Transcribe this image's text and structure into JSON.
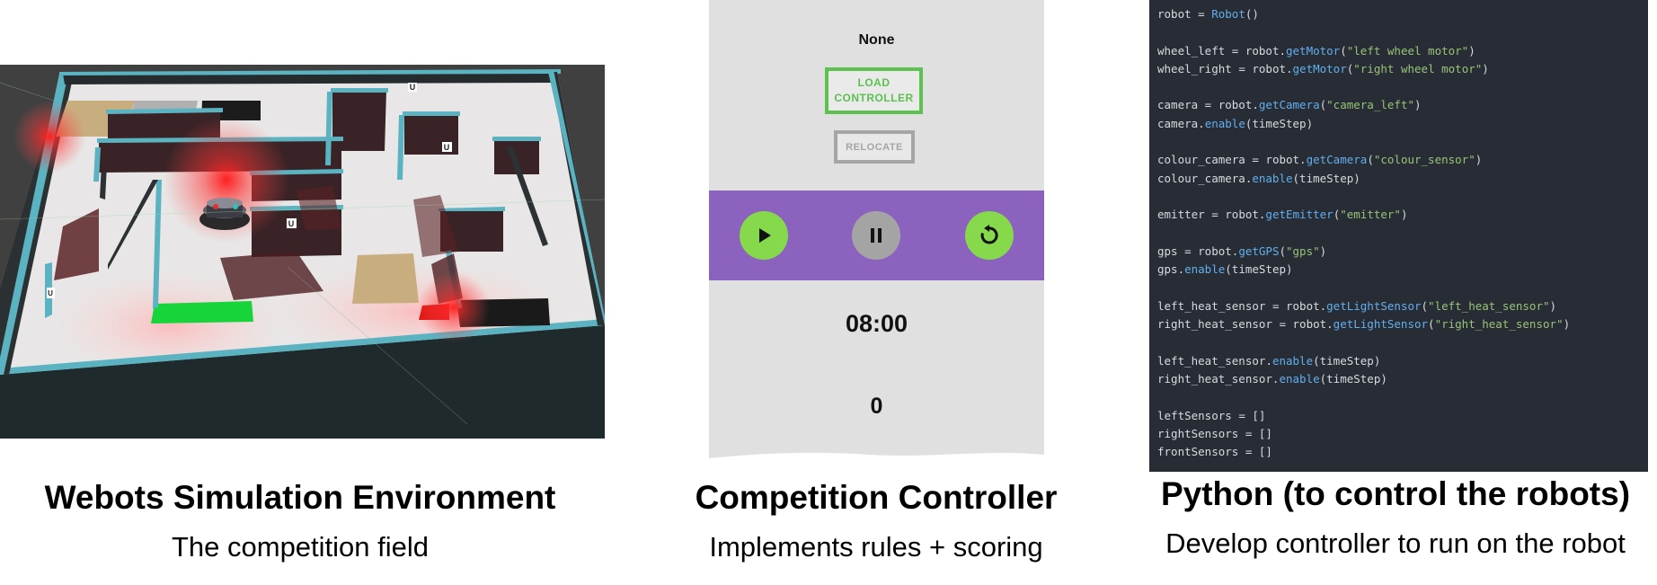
{
  "simulation": {
    "marker_labels": [
      "U",
      "U",
      "U",
      "U"
    ],
    "caption_title": "Webots Simulation Environment",
    "caption_subtitle": "The competition field"
  },
  "controller": {
    "status_label": "None",
    "load_button_label": "LOAD\nCONTROLLER",
    "relocate_button_label": "RELOCATE",
    "timer": "08:00",
    "score": "0",
    "colors": {
      "control_bar": "#8b63bf",
      "active_button": "#86d94a",
      "inactive_button": "#a4a4a4",
      "load_border": "#5cc14e"
    },
    "icons": [
      "play-icon",
      "pause-icon",
      "reset-icon"
    ],
    "caption_title": "Competition Controller",
    "caption_subtitle": "Implements rules + scoring"
  },
  "code": {
    "lines": [
      [
        [
          "var",
          "robot"
        ],
        [
          "op",
          " = "
        ],
        [
          "call",
          "Robot"
        ],
        [
          "punc",
          "()"
        ]
      ],
      [],
      [
        [
          "var",
          "wheel_left"
        ],
        [
          "op",
          " = "
        ],
        [
          "var",
          "robot."
        ],
        [
          "call",
          "getMotor"
        ],
        [
          "punc",
          "("
        ],
        [
          "str",
          "\"left wheel motor\""
        ],
        [
          "punc",
          ")"
        ]
      ],
      [
        [
          "var",
          "wheel_right"
        ],
        [
          "op",
          " = "
        ],
        [
          "var",
          "robot."
        ],
        [
          "call",
          "getMotor"
        ],
        [
          "punc",
          "("
        ],
        [
          "str",
          "\"right wheel motor\""
        ],
        [
          "punc",
          ")"
        ]
      ],
      [],
      [
        [
          "var",
          "camera"
        ],
        [
          "op",
          " = "
        ],
        [
          "var",
          "robot."
        ],
        [
          "call",
          "getCamera"
        ],
        [
          "punc",
          "("
        ],
        [
          "str",
          "\"camera_left\""
        ],
        [
          "punc",
          ")"
        ]
      ],
      [
        [
          "var",
          "camera."
        ],
        [
          "call",
          "enable"
        ],
        [
          "punc",
          "(timeStep)"
        ]
      ],
      [],
      [
        [
          "var",
          "colour_camera"
        ],
        [
          "op",
          " = "
        ],
        [
          "var",
          "robot."
        ],
        [
          "call",
          "getCamera"
        ],
        [
          "punc",
          "("
        ],
        [
          "str",
          "\"colour_sensor\""
        ],
        [
          "punc",
          ")"
        ]
      ],
      [
        [
          "var",
          "colour_camera."
        ],
        [
          "call",
          "enable"
        ],
        [
          "punc",
          "(timeStep)"
        ]
      ],
      [],
      [
        [
          "var",
          "emitter"
        ],
        [
          "op",
          " = "
        ],
        [
          "var",
          "robot."
        ],
        [
          "call",
          "getEmitter"
        ],
        [
          "punc",
          "("
        ],
        [
          "str",
          "\"emitter\""
        ],
        [
          "punc",
          ")"
        ]
      ],
      [],
      [
        [
          "var",
          "gps"
        ],
        [
          "op",
          " = "
        ],
        [
          "var",
          "robot."
        ],
        [
          "call",
          "getGPS"
        ],
        [
          "punc",
          "("
        ],
        [
          "str",
          "\"gps\""
        ],
        [
          "punc",
          ")"
        ]
      ],
      [
        [
          "var",
          "gps."
        ],
        [
          "call",
          "enable"
        ],
        [
          "punc",
          "(timeStep)"
        ]
      ],
      [],
      [
        [
          "var",
          "left_heat_sensor"
        ],
        [
          "op",
          " = "
        ],
        [
          "var",
          "robot."
        ],
        [
          "call",
          "getLightSensor"
        ],
        [
          "punc",
          "("
        ],
        [
          "str",
          "\"left_heat_sensor\""
        ],
        [
          "punc",
          ")"
        ]
      ],
      [
        [
          "var",
          "right_heat_sensor"
        ],
        [
          "op",
          " = "
        ],
        [
          "var",
          "robot."
        ],
        [
          "call",
          "getLightSensor"
        ],
        [
          "punc",
          "("
        ],
        [
          "str",
          "\"right_heat_sensor\""
        ],
        [
          "punc",
          ")"
        ]
      ],
      [],
      [
        [
          "var",
          "left_heat_sensor."
        ],
        [
          "call",
          "enable"
        ],
        [
          "punc",
          "(timeStep)"
        ]
      ],
      [
        [
          "var",
          "right_heat_sensor."
        ],
        [
          "call",
          "enable"
        ],
        [
          "punc",
          "(timeStep)"
        ]
      ],
      [],
      [
        [
          "var",
          "leftSensors"
        ],
        [
          "op",
          " = "
        ],
        [
          "punc",
          "[]"
        ]
      ],
      [
        [
          "var",
          "rightSensors"
        ],
        [
          "op",
          " = "
        ],
        [
          "punc",
          "[]"
        ]
      ],
      [
        [
          "var",
          "frontSensors"
        ],
        [
          "op",
          " = "
        ],
        [
          "punc",
          "[]"
        ]
      ]
    ],
    "syntax_colors": {
      "background": "#282c34",
      "text": "#d7dae0",
      "function": "#61afef",
      "string": "#98c379"
    },
    "caption_title": "Python (to control the robots)",
    "caption_subtitle": "Develop controller to run on the robot"
  }
}
